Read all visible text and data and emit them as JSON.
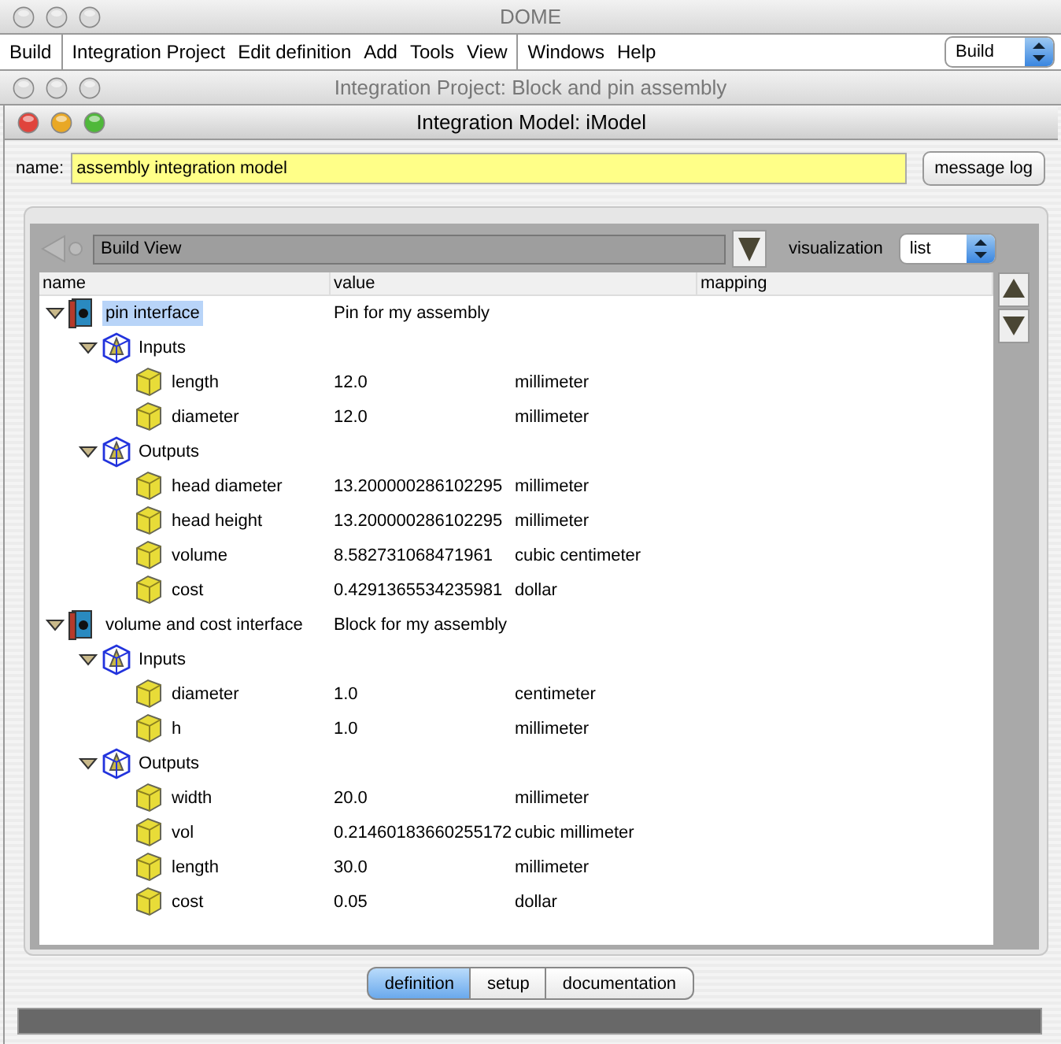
{
  "app_window": {
    "title": "DOME"
  },
  "menu_groups": [
    [
      "Build"
    ],
    [
      "Integration Project",
      "Edit definition",
      "Add",
      "Tools",
      "View"
    ],
    [
      "Windows",
      "Help"
    ]
  ],
  "mode_select": {
    "value": "Build"
  },
  "project_window": {
    "title": "Integration Project: Block and pin assembly"
  },
  "model_window": {
    "title": "Integration Model: iModel",
    "name_label": "name:",
    "name_value": "assembly integration model",
    "message_log_button": "message log",
    "view_bar": {
      "view": "Build View",
      "visualization_label": "visualization",
      "visualization_value": "list"
    },
    "table": {
      "columns": [
        "name",
        "value",
        "mapping"
      ],
      "rows": [
        {
          "kind": "interface",
          "name": "pin interface",
          "value": "Pin  for my assembly",
          "expanded": true,
          "selected": true,
          "children": [
            {
              "kind": "group",
              "name": "Inputs",
              "expanded": true,
              "selected": false,
              "children": [
                {
                  "kind": "parameter",
                  "name": "length",
                  "value": "12.0",
                  "unit": "millimeter",
                  "selected": false
                },
                {
                  "kind": "parameter",
                  "name": "diameter",
                  "value": "12.0",
                  "unit": "millimeter",
                  "selected": false
                }
              ]
            },
            {
              "kind": "group",
              "name": "Outputs",
              "expanded": true,
              "selected": false,
              "children": [
                {
                  "kind": "parameter",
                  "name": "head diameter",
                  "value": "13.200000286102295",
                  "unit": "millimeter",
                  "selected": false
                },
                {
                  "kind": "parameter",
                  "name": "head height",
                  "value": "13.200000286102295",
                  "unit": "millimeter",
                  "selected": false
                },
                {
                  "kind": "parameter",
                  "name": "volume",
                  "value": "8.582731068471961",
                  "unit": "cubic centimeter",
                  "selected": false
                },
                {
                  "kind": "parameter",
                  "name": "cost",
                  "value": "0.4291365534235981",
                  "unit": "dollar",
                  "selected": false
                }
              ]
            }
          ]
        },
        {
          "kind": "interface",
          "name": "volume and cost interface",
          "value": "Block for my assembly",
          "expanded": true,
          "selected": false,
          "children": [
            {
              "kind": "group",
              "name": "Inputs",
              "expanded": true,
              "selected": false,
              "children": [
                {
                  "kind": "parameter",
                  "name": "diameter",
                  "value": "1.0",
                  "unit": "centimeter",
                  "selected": false
                },
                {
                  "kind": "parameter",
                  "name": "h",
                  "value": "1.0",
                  "unit": "millimeter",
                  "selected": false
                }
              ]
            },
            {
              "kind": "group",
              "name": "Outputs",
              "expanded": true,
              "selected": false,
              "children": [
                {
                  "kind": "parameter",
                  "name": "width",
                  "value": "20.0",
                  "unit": "millimeter",
                  "selected": false
                },
                {
                  "kind": "parameter",
                  "name": "vol",
                  "value": "0.21460183660255172",
                  "unit": "cubic millimeter",
                  "selected": false
                },
                {
                  "kind": "parameter",
                  "name": "length",
                  "value": "30.0",
                  "unit": "millimeter",
                  "selected": false
                },
                {
                  "kind": "parameter",
                  "name": "cost",
                  "value": "0.05",
                  "unit": "dollar",
                  "selected": false
                }
              ]
            }
          ]
        }
      ]
    },
    "tabs": [
      {
        "label": "definition",
        "selected": true
      },
      {
        "label": "setup",
        "selected": false
      },
      {
        "label": "documentation",
        "selected": false
      }
    ]
  }
}
